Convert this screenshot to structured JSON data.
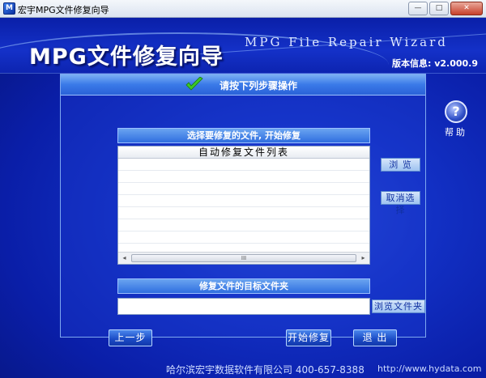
{
  "window": {
    "title": "宏宇MPG文件修复向导",
    "icon_label": "M",
    "minimize_glyph": "—",
    "maximize_glyph": "□",
    "close_glyph": "✕"
  },
  "banner": {
    "title": "MPG文件修复向导",
    "subtitle": "MPG File Repair Wizard",
    "version": "版本信息: v2.000.9"
  },
  "panel": {
    "instruction": "请按下列步骤操作",
    "select_section": "选择要修复的文件, 开始修复",
    "list_header": "自动修复文件列表",
    "target_section": "修复文件的目标文件夹",
    "target_value": ""
  },
  "buttons": {
    "browse": "浏 览",
    "cancel_selection": "取消选择",
    "browse_folder": "浏览文件夹",
    "prev": "上一步",
    "start": "开始修复",
    "exit": "退 出"
  },
  "help": {
    "label": "帮助",
    "glyph": "?"
  },
  "scrollbar": {
    "left": "◂",
    "right": "▸",
    "grip": "III"
  },
  "footer": {
    "company": "哈尔滨宏宇数据软件有限公司   400-657-8388",
    "url": "http://www.hydata.com"
  },
  "colors": {
    "accent": "#1230c4",
    "panel_header": "#3a7ae8",
    "check": "#3cc828"
  }
}
